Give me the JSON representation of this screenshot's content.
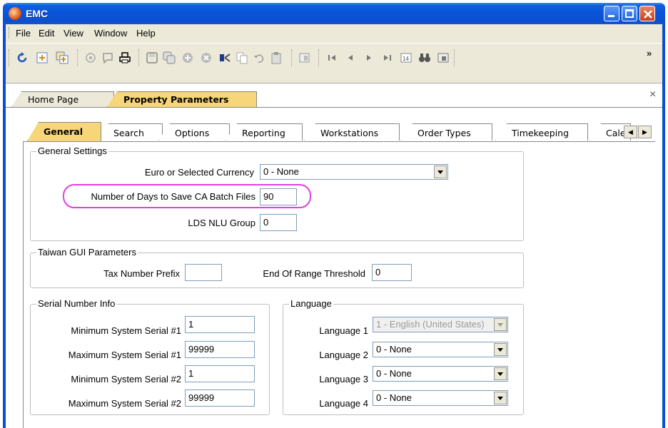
{
  "window": {
    "title": "EMC"
  },
  "menu": [
    "File",
    "Edit",
    "View",
    "Window",
    "Help"
  ],
  "toolbar": {
    "more": "»"
  },
  "doc_tabs": [
    "Home Page",
    "Property Parameters"
  ],
  "doc_close": "×",
  "tabs": [
    "General",
    "Search",
    "Options",
    "Reporting",
    "Workstations",
    "Order Types",
    "Timekeeping",
    "Cale"
  ],
  "general_settings": {
    "title": "General Settings",
    "currency_label": "Euro or Selected Currency",
    "currency_value": "0 - None",
    "batch_days_label": "Number of Days to Save CA Batch Files",
    "batch_days_value": "90",
    "lds_label": "LDS NLU Group",
    "lds_value": "0"
  },
  "taiwan": {
    "title": "Taiwan GUI Parameters",
    "tax_prefix_label": "Tax Number Prefix",
    "tax_prefix_value": "",
    "end_range_label": "End Of Range Threshold",
    "end_range_value": "0"
  },
  "serial": {
    "title": "Serial Number Info",
    "min1_label": "Minimum System Serial #1",
    "min1_value": "1",
    "max1_label": "Maximum System Serial #1",
    "max1_value": "99999",
    "min2_label": "Minimum System Serial #2",
    "min2_value": "1",
    "max2_label": "Maximum System Serial #2",
    "max2_value": "99999"
  },
  "language": {
    "title": "Language",
    "l1_label": "Language 1",
    "l1_value": "1 - English (United States)",
    "l2_label": "Language 2",
    "l2_value": "0 - None",
    "l3_label": "Language 3",
    "l3_value": "0 - None",
    "l4_label": "Language 4",
    "l4_value": "0 - None"
  }
}
